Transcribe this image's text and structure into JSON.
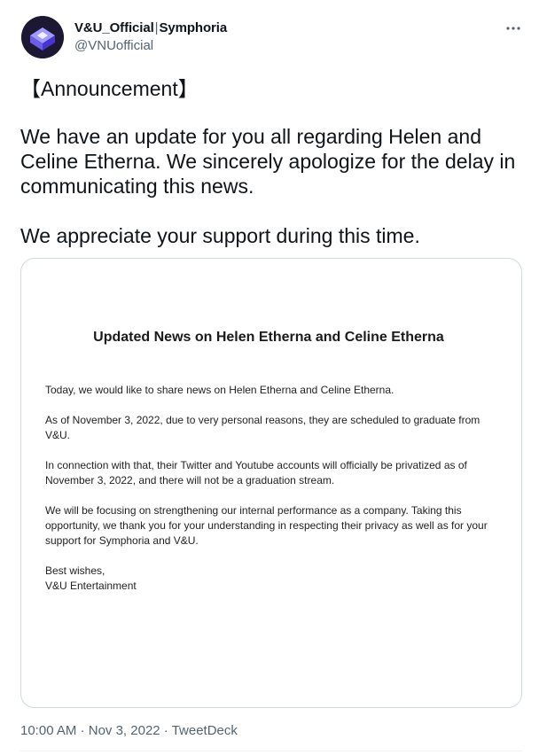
{
  "author": {
    "name": "V&U_Official",
    "separator": "|",
    "group": "Symphoria",
    "handle": "@VNUofficial",
    "avatar_icon": "vnu-logo-icon"
  },
  "menu": {
    "icon": "more-horizontal-icon"
  },
  "tweet": {
    "paragraphs": [
      "【Announcement】",
      "We have an update for you all regarding Helen and Celine Etherna. We sincerely apologize for the delay in communicating this news.",
      "We appreciate your support during this time."
    ]
  },
  "document": {
    "title": "Updated News on Helen Etherna and Celine Etherna",
    "paragraphs": [
      "Today, we would like to share news on Helen Etherna and Celine Etherna.",
      "As of November 3, 2022, due to very personal reasons, they are scheduled to graduate from V&U.",
      "In connection with that, their Twitter and Youtube accounts will officially be privatized as of November 3, 2022, and there will not be a graduation stream.",
      "We will be focusing on strengthening our internal performance as a company. Taking this opportunity, we thank you for your understanding in respecting their privacy as well as for your support for Symphoria and V&U."
    ],
    "closing": "Best wishes,",
    "signature": "V&U Entertainment"
  },
  "meta": {
    "time": "10:00 AM",
    "dot": "·",
    "date": "Nov 3, 2022",
    "source": "TweetDeck"
  },
  "colors": {
    "text": "#0f1419",
    "secondary": "#536471",
    "border": "#cfd9de",
    "avatar_bg": "#1a1a2e",
    "logo_primary": "#6c5ce7",
    "logo_light": "#a29bfe"
  }
}
